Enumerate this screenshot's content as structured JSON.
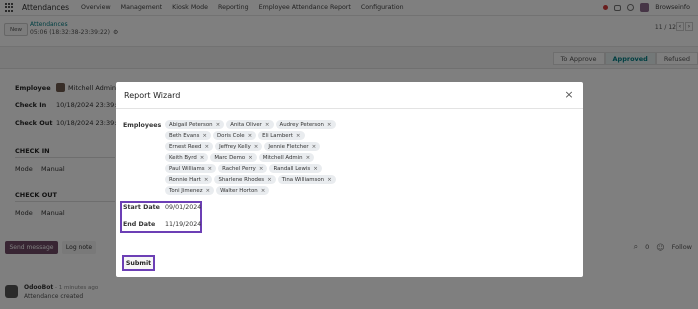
{
  "nav": {
    "app_name": "Attendances",
    "menu": [
      "Overview",
      "Management",
      "Kiosk Mode",
      "Reporting",
      "Employee Attendance Report",
      "Configuration"
    ],
    "company": "Browseinfo"
  },
  "control": {
    "new_label": "New",
    "breadcrumb": "Attendances",
    "record_name": "05:06 (18:32:38-23:39:22)",
    "pager": "11 / 12",
    "prev": "‹",
    "next": "›"
  },
  "status": {
    "stages": [
      "To Approve",
      "Approved",
      "Refused"
    ],
    "active": "Approved"
  },
  "form": {
    "employee_label": "Employee",
    "employee_value": "Mitchell Admin",
    "check_in_label": "Check In",
    "check_in_value": "10/18/2024 23:39:22",
    "check_out_label": "Check Out",
    "check_out_value": "10/18/2024 23:39:22",
    "section_check_in": "CHECK IN",
    "section_check_out": "CHECK OUT",
    "mode_label": "Mode",
    "mode_in_value": "Manual",
    "mode_out_value": "Manual"
  },
  "chatter": {
    "send_message": "Send message",
    "log_note": "Log note",
    "attach_count": "0",
    "follow": "Follow",
    "author": "OdooBot",
    "time": "- 1 minutes ago",
    "text": "Attendance created"
  },
  "modal": {
    "title": "Report Wizard",
    "close": "×",
    "employees_label": "Employees",
    "employees": [
      "Abigail Peterson",
      "Anita Oliver",
      "Audrey Peterson",
      "Beth Evans",
      "Doris Cole",
      "Eli Lambert",
      "Ernest Reed",
      "Jeffrey Kelly",
      "Jennie Fletcher",
      "Keith Byrd",
      "Marc Demo",
      "Mitchell Admin",
      "Paul Williams",
      "Rachel Perry",
      "Randall Lewis",
      "Ronnie Hart",
      "Sharlene Rhodes",
      "Tina Williamson",
      "Toni Jimenez",
      "Walter Horton"
    ],
    "tag_remove": "×",
    "start_date_label": "Start Date",
    "start_date_value": "09/01/2024",
    "end_date_label": "End Date",
    "end_date_value": "11/19/2024",
    "submit": "Submit"
  }
}
